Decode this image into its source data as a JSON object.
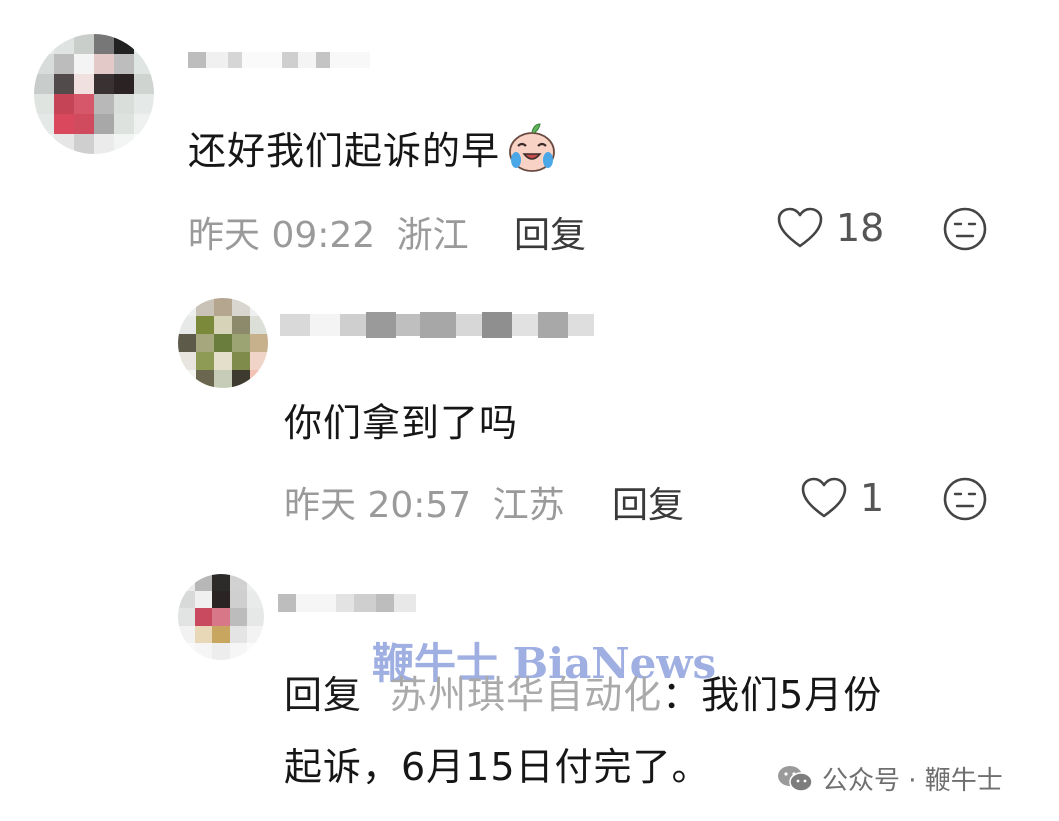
{
  "comments": [
    {
      "text": "还好我们起诉的早",
      "emoji": "crying-laughing-emoji",
      "time": "昨天 09:22",
      "location": "浙江",
      "reply_label": "回复",
      "likes": "18"
    },
    {
      "text": "你们拿到了吗",
      "time": "昨天 20:57",
      "location": "江苏",
      "reply_label": "回复",
      "likes": "1"
    },
    {
      "reply_prefix": "回复",
      "reply_to": "苏州琪华自动化",
      "text_line1": "：我们5月份",
      "text_line2": "起诉，6月15日付完了。"
    }
  ],
  "watermark": "鞭牛士 BiaNews",
  "source": {
    "icon": "wechat-icon",
    "label": "公众号 · 鞭牛士"
  }
}
